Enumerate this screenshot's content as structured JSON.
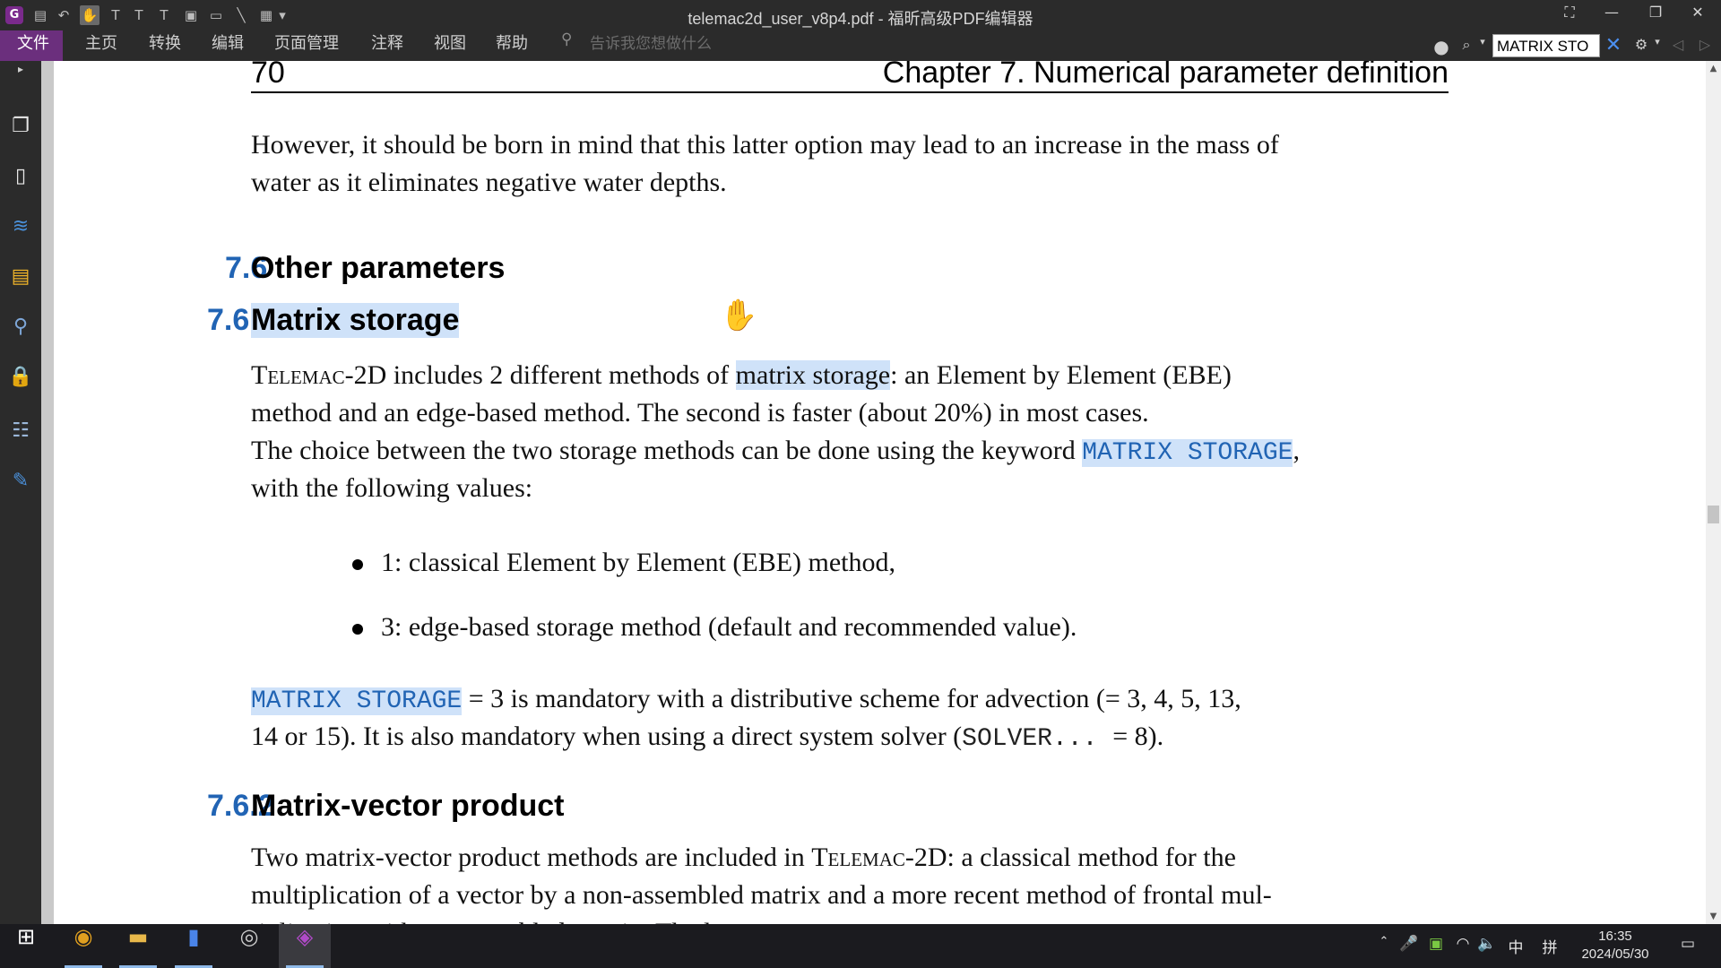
{
  "window": {
    "title": "telemac2d_user_v8p4.pdf - 福昕高级PDF编辑器",
    "app_logo": "G"
  },
  "menu": {
    "file": "文件",
    "items": [
      "主页",
      "转换",
      "编辑",
      "页面管理",
      "注释",
      "视图",
      "帮助"
    ],
    "tell_me_placeholder": "告诉我您想做什么"
  },
  "search": {
    "value": "MATRIX STO"
  },
  "page": {
    "number": "70",
    "running_head": "Chapter 7. Numerical parameter definition",
    "intro_line1": "However, it should be born in mind that this latter option may lead to an increase in the mass of",
    "intro_line2": "water as it eliminates negative water depths.",
    "sec_76_num": "7.6",
    "sec_76_title": "Other parameters",
    "sec_761_num": "7.6.1",
    "sec_761_title": "Matrix storage",
    "p1_telemac": "Telemac",
    "p1_a": "-2D includes 2 different methods of ",
    "p1_hl": "matrix storage",
    "p1_b": ": an Element by Element (EBE)",
    "p1_line2": "method and an edge-based method. The second is faster (about 20%) in most cases.",
    "p2_a": "The choice between the two storage methods can be done using the keyword ",
    "p2_kw": "MATRIX STORAGE",
    "p2_b": ",",
    "p2_line2": "with the following values:",
    "bullets": [
      "1: classical Element by Element (EBE) method,",
      "3: edge-based storage method (default and recommended value)."
    ],
    "p3_kw": "MATRIX STORAGE",
    "p3_a": " = 3 is mandatory with a distributive scheme for advection (= 3, 4, 5, 13,",
    "p3_line2_a": "14 or 15). It is also mandatory when using a direct system solver (",
    "p3_line2_kw": "SOLVER... ",
    "p3_line2_b": "= 8).",
    "sec_762_num": "7.6.2",
    "sec_762_title": "Matrix-vector product",
    "p4_a": "Two matrix-vector product methods are included in ",
    "p4_telemac": "Telemac",
    "p4_b": "-2D: a classical method for the",
    "p4_line2": "multiplication of a vector by a non-assembled matrix and a more recent method of frontal mul-",
    "p4_line3": "tiplication with an assembled matrix. The latter can ..."
  },
  "taskbar": {
    "time": "16:35",
    "date": "2024/05/30",
    "ime_lang": "中",
    "ime_mode": "拼"
  },
  "colors": {
    "accent_purple": "#6b2f7d",
    "heading_blue": "#2164b4",
    "highlight": "#cfe2f9",
    "chrome_dark": "#2b2b2b"
  }
}
